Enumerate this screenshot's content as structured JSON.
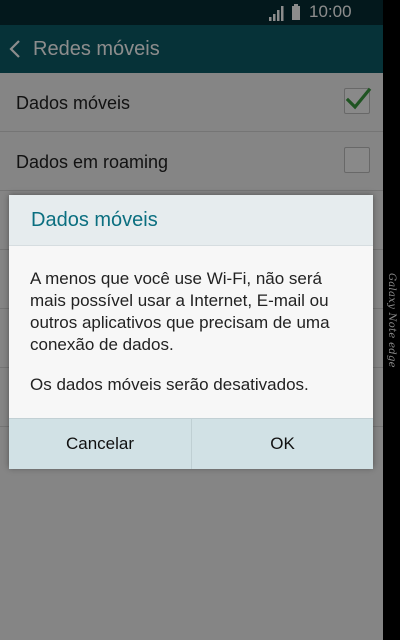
{
  "status_bar": {
    "time": "10:00",
    "signal_icon": "signal-bars-icon",
    "battery_icon": "battery-icon"
  },
  "action_bar": {
    "title": "Redes móveis",
    "back_icon": "chevron-left-icon"
  },
  "settings": [
    {
      "label": "Dados móveis",
      "checked": true
    },
    {
      "label": "Dados em roaming",
      "checked": false
    }
  ],
  "dialog": {
    "title": "Dados móveis",
    "message": "A menos que você use Wi-Fi, não será mais possível usar a Internet, E-mail ou outros aplicativos que precisam de uma conexão de dados.",
    "message_2": "Os dados móveis serão desativados.",
    "cancel_label": "Cancelar",
    "ok_label": "OK"
  },
  "device": {
    "edge_brand": "Galaxy Note edge"
  },
  "colors": {
    "action_bar": "#0b5c67",
    "status_bar": "#062d33",
    "dialog_title": "#0b6f80",
    "check": "#3a9a3f",
    "dialog_buttons": "#d1e1e5"
  }
}
